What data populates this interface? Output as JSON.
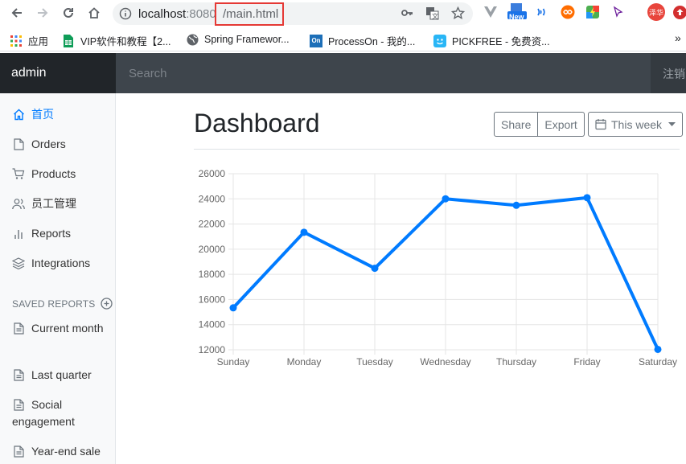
{
  "browser": {
    "url_host": "localhost",
    "url_port": ":8080",
    "url_path": "/main.html",
    "bookmarks": [
      {
        "label": "应用",
        "icon": "apps-grid-icon"
      },
      {
        "label": "VIP软件和教程【2...",
        "icon": "sheets-icon"
      },
      {
        "label": "Spring Framewor...",
        "icon": "globe-icon"
      },
      {
        "label": "ProcessOn - 我的...",
        "icon": "processon-icon"
      },
      {
        "label": "PICKFREE - 免费资...",
        "icon": "pickfree-icon"
      }
    ],
    "extensions": {
      "new_badge": "New",
      "avatar_text": "泽华"
    }
  },
  "navbar": {
    "brand": "admin",
    "search_placeholder": "Search",
    "signout": "注销"
  },
  "sidebar": {
    "items": [
      {
        "label": "首页",
        "icon": "home-icon",
        "active": true
      },
      {
        "label": "Orders",
        "icon": "file-icon"
      },
      {
        "label": "Products",
        "icon": "shopping-cart-icon"
      },
      {
        "label": "员工管理",
        "icon": "users-icon"
      },
      {
        "label": "Reports",
        "icon": "bar-chart-icon"
      },
      {
        "label": "Integrations",
        "icon": "layers-icon"
      }
    ],
    "saved_reports_heading": "SAVED REPORTS",
    "reports": [
      {
        "label": "Current month"
      },
      {
        "label": "Last quarter"
      },
      {
        "label": "Social engagement"
      },
      {
        "label": "Year-end sale"
      }
    ]
  },
  "main": {
    "title": "Dashboard",
    "share_label": "Share",
    "export_label": "Export",
    "range_label": "This week"
  },
  "chart_data": {
    "type": "line",
    "categories": [
      "Sunday",
      "Monday",
      "Tuesday",
      "Wednesday",
      "Thursday",
      "Friday",
      "Saturday"
    ],
    "series": [
      {
        "values": [
          15339,
          21345,
          18483,
          24003,
          23489,
          24092,
          12034
        ]
      }
    ],
    "ylim": [
      12000,
      26000
    ],
    "yticks": [
      12000,
      14000,
      16000,
      18000,
      20000,
      22000,
      24000,
      26000
    ],
    "grid": true,
    "color": "#007bff",
    "legend": "none"
  }
}
